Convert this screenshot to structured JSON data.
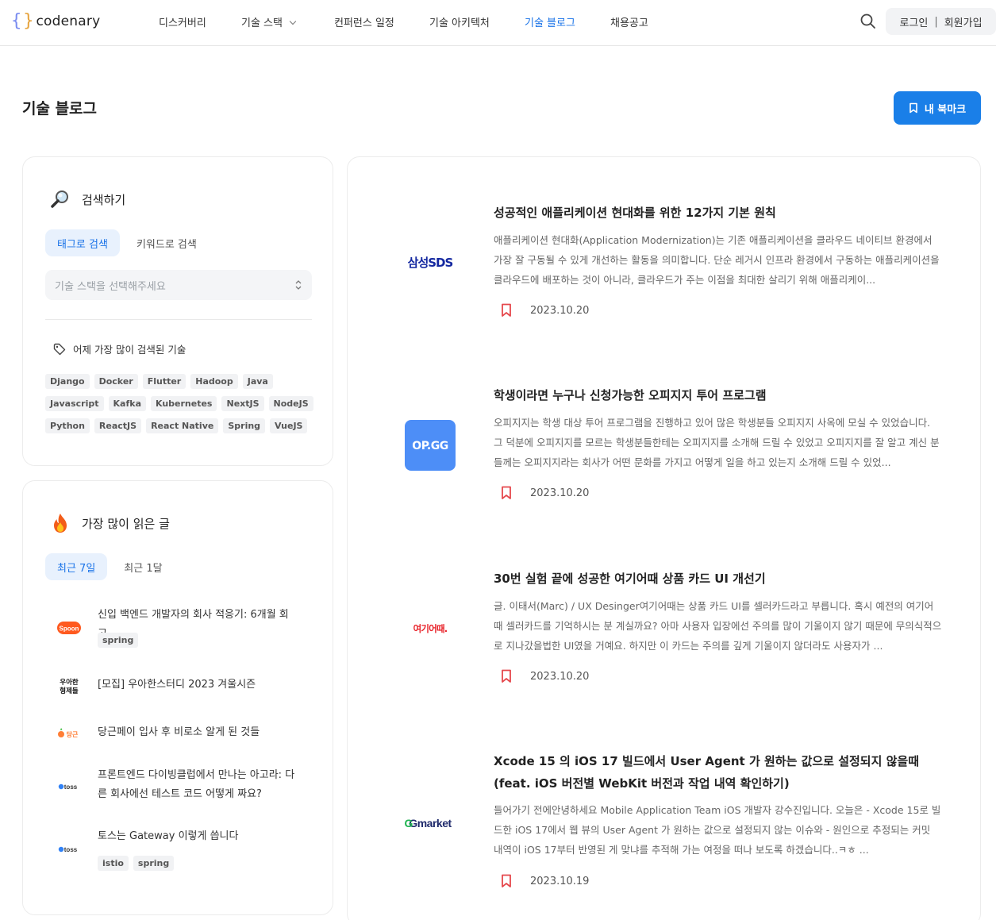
{
  "header": {
    "logo_open": "{",
    "logo_close": "}",
    "logo_text": "codenary",
    "nav": [
      {
        "label": "디스커버리"
      },
      {
        "label": "기술 스택"
      },
      {
        "label": "컨퍼런스 일정"
      },
      {
        "label": "기술 아키텍처"
      },
      {
        "label": "기술 블로그"
      },
      {
        "label": "채용공고"
      }
    ],
    "active_nav": "기술 블로그",
    "login": "로그인",
    "separator": "|",
    "signup": "회원가입",
    "search_icon": "search-icon"
  },
  "page": {
    "title": "기술 블로그",
    "bookmark_button": "내 북마크"
  },
  "search_panel": {
    "title": "검색하기",
    "tabs": [
      "태그로 검색",
      "키워드로 검색"
    ],
    "select_placeholder": "기술 스택을 선택해주세요",
    "yesterday_title": "어제 가장 많이 검색된 기술",
    "tags": [
      [
        "Django",
        "Docker",
        "Flutter",
        "Hadoop",
        "Java"
      ],
      [
        "Javascript",
        "Kafka",
        "Kubernetes",
        "NextJS",
        "NodeJS"
      ],
      [
        "Python",
        "ReactJS",
        "React Native",
        "Spring",
        "VueJS"
      ]
    ]
  },
  "popular_panel": {
    "title": "가장 많이 읽은 글",
    "tabs": [
      "최근 7일",
      "최근 1달"
    ],
    "items": [
      {
        "logo": "Spoon",
        "title": "신입 백엔드 개발자의 회사 적응기: 6개월 회고",
        "tags": [
          "spring"
        ]
      },
      {
        "logo": "우아한 형제들",
        "title": "[모집] 우아한스터디 2023 겨울시즌",
        "tags": []
      },
      {
        "logo": "당근",
        "title": "당근페이 입사 후 비로소 알게 된 것들",
        "tags": []
      },
      {
        "logo": "toss",
        "title": "프론트엔드 다이빙클럽에서 만나는 아고라: 다른 회사에선 테스트 코드 어떻게 짜요?",
        "tags": []
      },
      {
        "logo": "toss",
        "title": "토스는 Gateway 이렇게 씁니다",
        "tags": [
          "istio",
          "spring"
        ]
      }
    ]
  },
  "feed": {
    "posts": [
      {
        "logo": "삼성SDS",
        "title": "성공적인 애플리케이션 현대화를 위한 12가지 기본 원칙",
        "desc": "애플리케이션 현대화(Application Modernization)는 기존 애플리케이션을 클라우드 네이티브 환경에서 가장 잘 구동될 수 있게 개선하는 활동을 의미합니다. 단순 레거시 인프라 환경에서 구동하는 애플리케이션을 클라우드에 배포하는 것이 아니라, 클라우드가 주는 이점을 최대한 살리기 위해 애플리케이...",
        "date": "2023.10.20"
      },
      {
        "logo": "OP.GG",
        "title": "학생이라면 누구나 신청가능한 오피지지 투어 프로그램",
        "desc": "오피지지는 학생 대상 투어 프로그램을 진행하고 있어 많은 학생분들 오피지지 사옥에 모실 수 있었습니다. 그 덕분에 오피지지를 모르는 학생분들한테는 오피지지를 소개해 드릴 수 있었고 오피지지를 잘 알고 계신 분들께는 오피지지라는 회사가 어떤 문화를 가지고 어떻게 일을 하고 있는지 소개해 드릴 수 있었...",
        "date": "2023.10.20"
      },
      {
        "logo": "여기어때.",
        "title": "30번 실험 끝에 성공한 여기어때 상품 카드 UI 개선기",
        "desc": "글. 이태서(Marc) / UX Desinger여기어때는 상품 카드 UI를 셀러카드라고 부릅니다. 혹시 예전의 여기어때 셀러카드를 기억하시는 분 계실까요? 아마 사용자 입장에선 주의를 많이 기울이지 않기 때문에 무의식적으로 지나갔을법한 UI였을 거예요. 하지만 이 카드는 주의를 깊게 기울이지 않더라도 사용자가 ...",
        "date": "2023.10.20"
      },
      {
        "logo": "Gmarket",
        "title": "Xcode 15 의 iOS 17 빌드에서 User Agent 가 원하는 값으로 설정되지 않을때 (feat. iOS 버전별 WebKit 버전과 작업 내역 확인하기)",
        "desc": "들어가기 전에안녕하세요 Mobile Application Team iOS 개발자 강수진입니다. 오늘은 - Xcode 15로 빌드한 iOS 17에서 웹 뷰의 User Agent 가 원하는 값으로 설정되지 않는 이슈와 - 원인으로 추정되는 커밋 내역이 iOS 17부터 반영된 게 맞냐를 추적해 가는 여정을 떠나 보도록 하겠습니다..ㅋㅎ ...",
        "date": "2023.10.19"
      }
    ]
  },
  "colors": {
    "accent": "#1a73e8",
    "primary_button": "#1a7fe8",
    "bookmark_icon": "#e5484d",
    "samsung": "#1428a0",
    "opgg": "#4d8ef7",
    "yeogi": "#e8232a",
    "spoon": "#ff5a1f",
    "danggeun": "#ff7e36",
    "toss": "#3182f6"
  }
}
